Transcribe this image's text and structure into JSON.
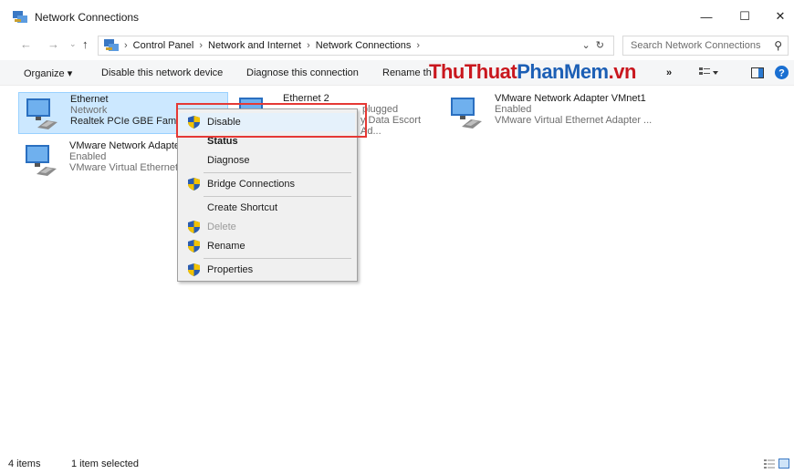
{
  "window": {
    "title": "Network Connections",
    "controls": [
      "—",
      "☐",
      "✕"
    ]
  },
  "address": {
    "crumbs": [
      "Control Panel",
      "Network and Internet",
      "Network Connections"
    ],
    "search_placeholder": "Search Network Connections"
  },
  "commands": {
    "organize": "Organize ▾",
    "disable": "Disable this network device",
    "diagnose": "Diagnose this connection",
    "rename": "Rename th",
    "more": "»"
  },
  "watermark": {
    "part1": "ThuThuat",
    "part2": "PhanMem",
    "part3": ".vn"
  },
  "items": [
    {
      "name": "Ethernet",
      "status": "Network",
      "device": "Realtek PCIe GBE Family"
    },
    {
      "name": "Ethernet 2",
      "status": "plugged",
      "device": "y Data Escort Ad..."
    },
    {
      "name": "VMware Network Adapter VMnet1",
      "status": "Enabled",
      "device": "VMware Virtual Ethernet Adapter ..."
    },
    {
      "name": "VMware Network Adapte",
      "status": "Enabled",
      "device": "VMware Virtual Ethernet"
    }
  ],
  "menu": {
    "disable": "Disable",
    "status": "Status",
    "diagnose": "Diagnose",
    "bridge": "Bridge Connections",
    "shortcut": "Create Shortcut",
    "delete": "Delete",
    "rename": "Rename",
    "properties": "Properties"
  },
  "status": {
    "count": "4 items",
    "selected": "1 item selected"
  },
  "colors": {
    "accent": "#0078d7",
    "selection": "#cce8ff",
    "highlight_box": "#e53935",
    "watermark_red": "#c9171e"
  }
}
